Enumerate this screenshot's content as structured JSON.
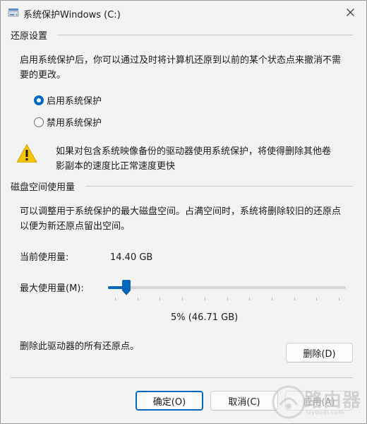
{
  "window": {
    "title": "系统保护Windows (C:)"
  },
  "restore_settings": {
    "heading": "还原设置",
    "description_line1": "启用系统保护后，你可以通过及时将计算机还原到以前的某个状态点来撤消不需",
    "description_line2": "要的更改。",
    "options": [
      {
        "label": "启用系统保护",
        "selected": true
      },
      {
        "label": "禁用系统保护",
        "selected": false
      }
    ],
    "warning_line1": "如果对包含系统映像备份的驱动器使用系统保护，将使得删除其他卷",
    "warning_line2": "影副本的速度比正常速度更快"
  },
  "disk_usage": {
    "heading": "磁盘空间使用量",
    "description_line1": "可以调整用于系统保护的最大磁盘空间。占满空间时，系统将删除较旧的还原点",
    "description_line2": "以便为新还原点留出空间。",
    "current_label": "当前使用量:",
    "current_value": "14.40 GB",
    "max_label": "最大使用量(M):",
    "max_percent": 5,
    "max_value_text": "5% (46.71 GB)",
    "delete_text": "删除此驱动器的所有还原点。",
    "delete_button": "删除(D)"
  },
  "footer": {
    "ok": "确定(O)",
    "cancel": "取消(C)",
    "apply": "应用(A)"
  },
  "watermark": {
    "text": "路由器",
    "sub": "luyouqi.com"
  },
  "colors": {
    "accent": "#0067c0",
    "warning": "#f7c600"
  }
}
